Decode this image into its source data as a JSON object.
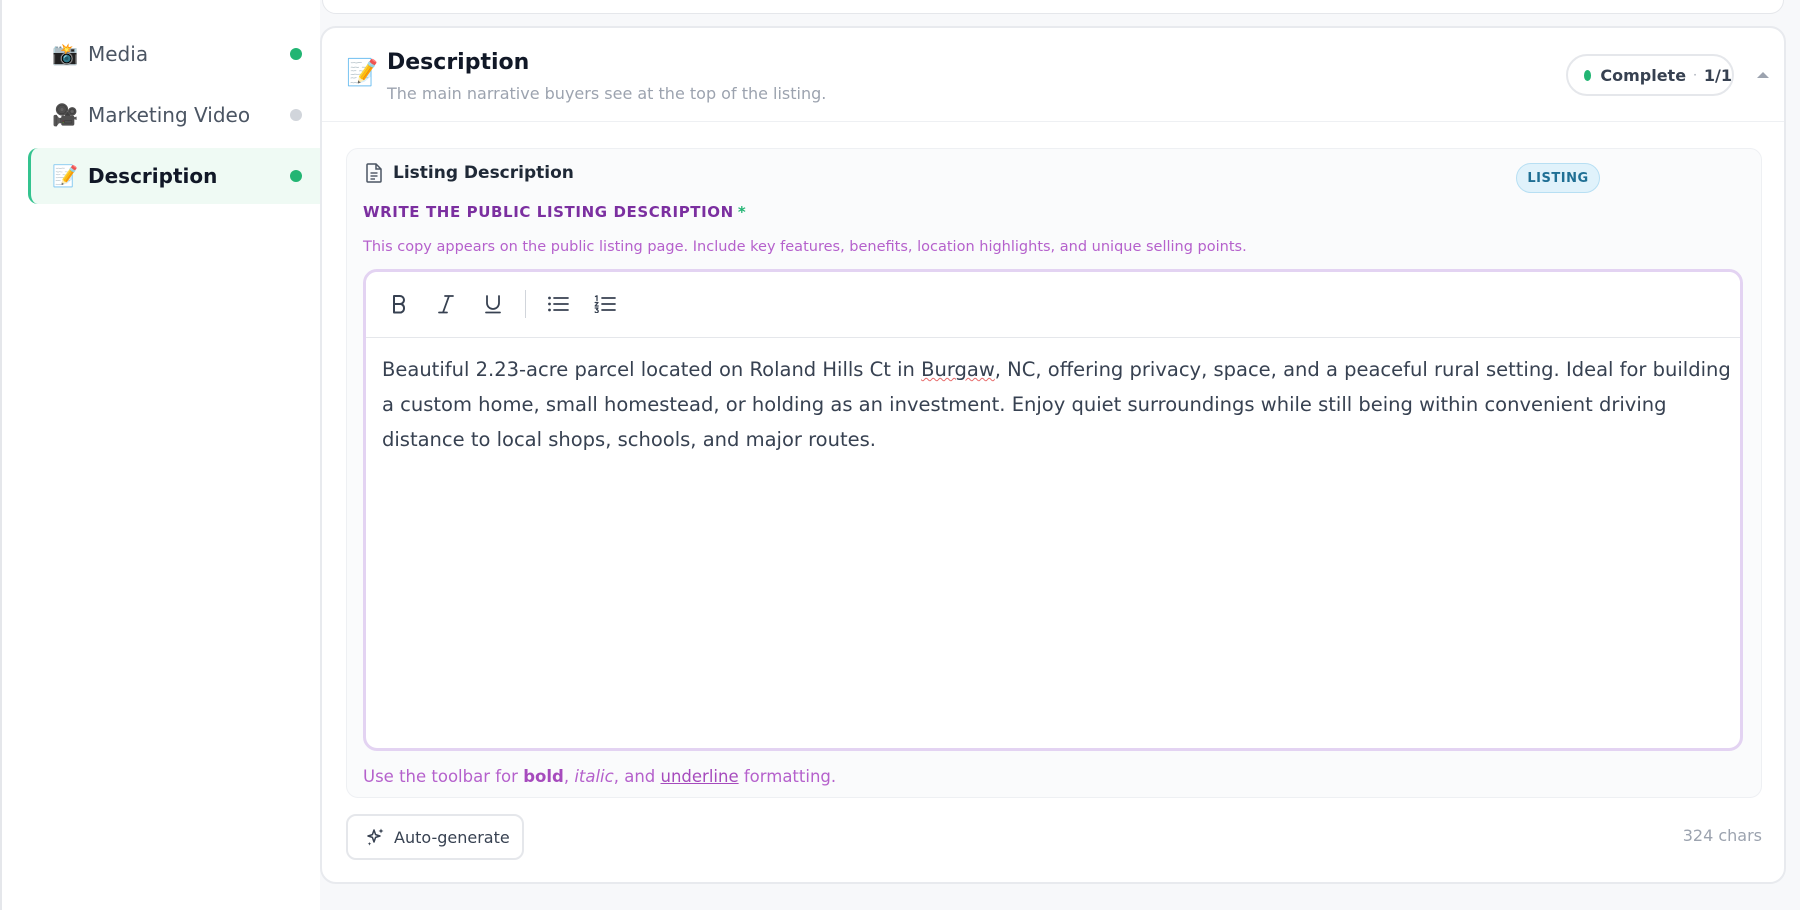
{
  "sidebar": {
    "items": [
      {
        "emoji": "📸",
        "icon": "camera-icon",
        "label": "Media",
        "status_color": "#22b573"
      },
      {
        "emoji": "🎥",
        "icon": "video-camera-icon",
        "label": "Marketing Video",
        "status_color": "#d1d5db"
      },
      {
        "emoji": "📝",
        "icon": "memo-icon",
        "label": "Description",
        "status_color": "#22b573",
        "active": true
      }
    ]
  },
  "section": {
    "emoji": "📝",
    "title": "Description",
    "subtitle": "The main narrative buyers see at the top of the listing.",
    "status": {
      "label": "Complete",
      "separator": "·",
      "count": "1/1",
      "color": "#22b573"
    }
  },
  "field": {
    "title": "Listing Description",
    "badge": "LISTING",
    "label": "WRITE THE PUBLIC LISTING DESCRIPTION",
    "required_mark": "*",
    "help": "This copy appears on the public listing page. Include key features, benefits, location highlights, and unique selling points.",
    "toolbar": [
      "bold-icon",
      "italic-icon",
      "underline-icon",
      "bulleted-list-icon",
      "numbered-list-icon"
    ],
    "text_before": "Beautiful 2.23-acre parcel located on Roland Hills Ct in ",
    "text_misspelled": "Burgaw",
    "text_after": ", NC, offering privacy, space, and a peaceful rural setting. Ideal for building a custom home, small homestead, or holding as an investment. Enjoy quiet surroundings while still being within convenient driving distance to local shops, schools, and major routes.",
    "hint": {
      "prefix": "Use the toolbar for ",
      "bold": "bold",
      "comma": ", ",
      "italic": "italic",
      "and": ", and ",
      "underline": "underline",
      "suffix": " formatting."
    }
  },
  "footer": {
    "autogen_label": "Auto-generate",
    "char_count": "324 chars"
  }
}
